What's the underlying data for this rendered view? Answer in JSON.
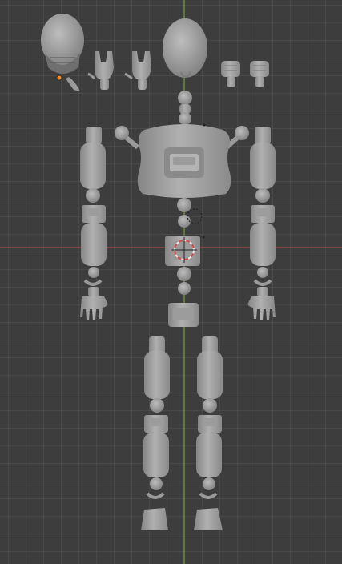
{
  "viewport": {
    "name": "3D Viewport",
    "colors": {
      "background": "#3d3d3d",
      "grid": "#4a4a4a",
      "x_axis": "#a84a52",
      "y_axis": "#6c9a2a",
      "mesh": "#a9a9a9",
      "mesh_shadow": "#7c7c7c",
      "cursor_ring": "#e8e8e8",
      "cursor_red": "#d44a4a",
      "origin_dot": "#f08a24"
    },
    "icons": {
      "cursor": "3d-cursor-icon",
      "origin": "object-origin-icon"
    },
    "objects": [
      "head-front",
      "head-back",
      "hand-pose-rock",
      "fist-pose",
      "torso",
      "pelvis",
      "upper-arms",
      "forearms",
      "hands",
      "thighs",
      "shins",
      "feet"
    ]
  }
}
